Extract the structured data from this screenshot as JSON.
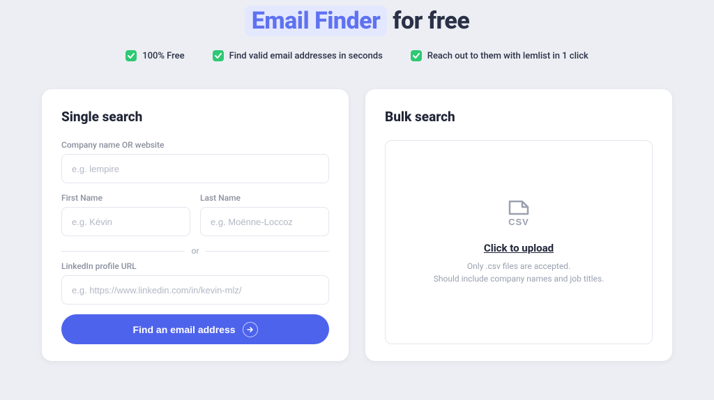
{
  "hero": {
    "highlight": "Email Finder",
    "rest": "for free"
  },
  "features": [
    "100% Free",
    "Find valid email addresses in seconds",
    "Reach out to them with lemlist in 1 click"
  ],
  "single": {
    "heading": "Single search",
    "company_label": "Company name OR website",
    "company_placeholder": "e.g. lempire",
    "first_label": "First Name",
    "first_placeholder": "e.g. Kévin",
    "last_label": "Last Name",
    "last_placeholder": "e.g. Moënne-Loccoz",
    "or": "or",
    "linkedin_label": "LinkedIn profile URL",
    "linkedin_placeholder": "e.g. https://www.linkedin.com/in/kevin-mlz/",
    "submit": "Find an email address"
  },
  "bulk": {
    "heading": "Bulk search",
    "upload_title": "Click to upload",
    "upload_line1": "Only .csv files are accepted.",
    "upload_line2": "Should include company names and job titles."
  }
}
